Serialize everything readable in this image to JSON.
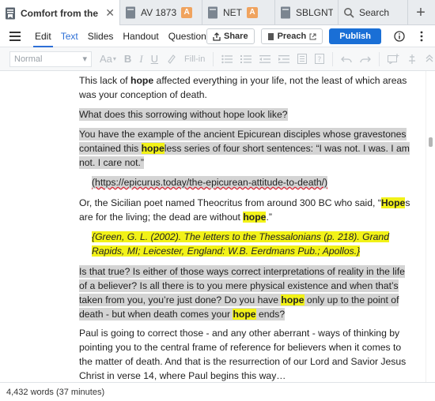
{
  "tabs": [
    {
      "label": "Comfort from the Rapture",
      "active": true,
      "icon": "document-icon",
      "close": "✕"
    },
    {
      "label": "AV 1873",
      "badge": "A",
      "icon": "book-icon"
    },
    {
      "label": "NET",
      "badge": "A",
      "icon": "book-icon"
    },
    {
      "label": "SBLGNT",
      "icon": "book-icon"
    },
    {
      "label": "Search",
      "icon": "search-icon"
    },
    {
      "label": "+",
      "icon": "add-icon"
    }
  ],
  "toolbar": {
    "menu": [
      "Edit",
      "Text",
      "Slides",
      "Handout",
      "Questions"
    ],
    "share": "Share",
    "preach": "Preach",
    "publish": "Publish"
  },
  "format": {
    "style": "Normal",
    "font_size": "Aa",
    "bold": "B",
    "italic": "I",
    "underline": "U",
    "fill_in": "Fill-in"
  },
  "content": {
    "p1_a": "This lack of ",
    "p1_kw": "hope",
    "p1_b": " affected everything in your life, not the least of which areas was your conception of death.",
    "p2": "What does this sorrowing without hope look like?",
    "p3_a": "You have the example of the ancient Epicurean disciples whose gravestones contained this ",
    "p3_kw": "hope",
    "p3_b": "less series of four short sentences: “I was not. I was. I am not. I care not.”",
    "p4": "(https://epicurus.today/the-epicurean-attitude-to-death/)",
    "p5_a": "Or, the Sicilian poet named Theocritus from around 300 BC who said, “",
    "p5_kw1": "Hope",
    "p5_b": "s are for the living; the dead are without ",
    "p5_kw2": "hope",
    "p5_c": ".”",
    "p6": "{Green, G. L. (2002). The letters to the Thessalonians (p. 218). Grand Rapids, MI; Leicester, England: W.B. Eerdmans Pub.; Apollos.}",
    "p7_a": "Is that true? Is either of those ways correct interpretations of reality in the life of a believer? Is all there is to you mere physical existence and when that’s taken from you, you’re just done? Do you have ",
    "p7_kw1": "hope",
    "p7_b": " only up to the point of death - but when death comes your ",
    "p7_kw2": "hope",
    "p7_c": " ends?",
    "p8": "Paul is going to correct those - and any other aberrant - ways of thinking by pointing you to the central frame of reference for believers when it comes to the matter of death. And that is the resurrection of our Lord and Savior Jesus Christ in verse 14, where Paul begins this way…"
  },
  "status": {
    "word_count": "4,432 words (37 minutes)"
  },
  "colors": {
    "accent": "#1a6fd6",
    "badge": "#f0a35e",
    "highlight_gray": "#d4d4d4",
    "highlight_yellow": "#f2f218"
  }
}
